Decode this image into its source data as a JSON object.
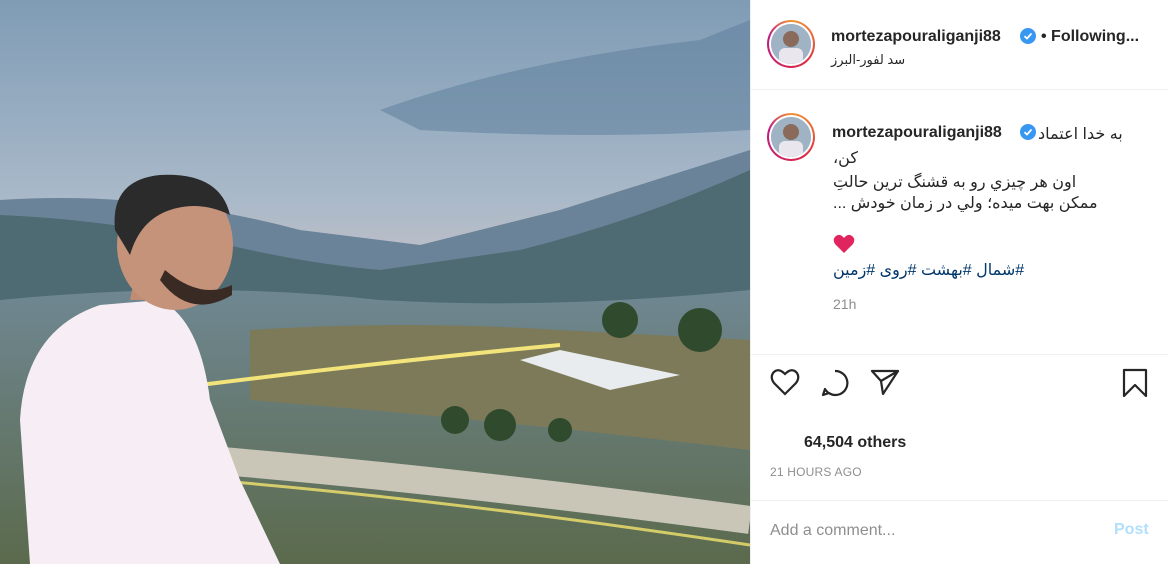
{
  "post": {
    "username": "mortezapouraliganji88",
    "follow_label": "• Following...",
    "location": "سد لفور-البرز",
    "caption": {
      "line1": "به خدا اعتماد",
      "line2": "کن،",
      "line3": "اون هر چیزي رو به قشنگ ترين حالتِ",
      "line4": "ممکن بهت ميده؛ ولي در زمان خودش ...",
      "hashtags": "#شمال #بهشت #روی #زمین"
    },
    "time_ago": "21h",
    "likes": "64,504 others",
    "date": "21 HOURS AGO"
  },
  "comment": {
    "placeholder": "Add a comment...",
    "post_label": "Post"
  },
  "icons": {
    "verified": "verified-badge-icon",
    "heart": "red-heart-emoji",
    "like": "heart-outline-icon",
    "comment": "comment-bubble-icon",
    "share": "paper-plane-icon",
    "save": "bookmark-icon"
  },
  "colors": {
    "verified": "#3897f0",
    "hashtag": "#00376b",
    "post_button": "#b2dffc",
    "heart_emoji": "#e0245e"
  }
}
